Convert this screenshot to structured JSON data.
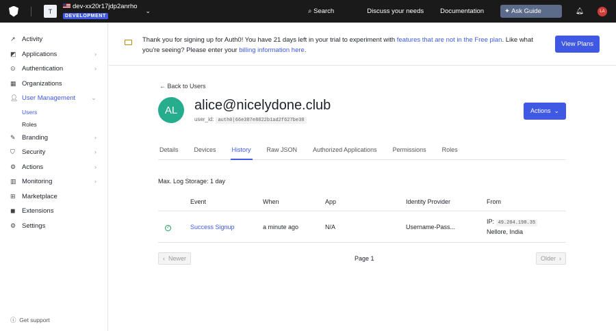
{
  "topbar": {
    "tenant_initial": "T",
    "tenant_name": "dev-xx20r17jdp2anrho",
    "env_badge": "DEVELOPMENT",
    "search": "Search",
    "discuss": "Discuss your needs",
    "docs": "Documentation",
    "ask": "Ask Guide",
    "user_initials": "LA"
  },
  "sidebar": {
    "items": [
      {
        "label": "Activity"
      },
      {
        "label": "Applications"
      },
      {
        "label": "Authentication"
      },
      {
        "label": "Organizations"
      },
      {
        "label": "User Management"
      },
      {
        "label": "Branding"
      },
      {
        "label": "Security"
      },
      {
        "label": "Actions"
      },
      {
        "label": "Monitoring"
      },
      {
        "label": "Marketplace"
      },
      {
        "label": "Extensions"
      },
      {
        "label": "Settings"
      }
    ],
    "sub": [
      "Users",
      "Roles"
    ],
    "support": "Get support"
  },
  "banner": {
    "t1": "Thank you for signing up for Auth0! You have 21 days left in your trial to experiment with ",
    "l1": "features that are not in the Free plan",
    "t2": ". Like what you're seeing? Please enter your ",
    "l2": "billing information here",
    "t3": ".",
    "button": "View Plans"
  },
  "user": {
    "back": "Back to Users",
    "initials": "AL",
    "email": "alice@nicelydone.club",
    "uid_label": "user_id:",
    "uid": "auth0|66e387e8822b1ad2f627be38",
    "actions": "Actions"
  },
  "tabs": [
    "Details",
    "Devices",
    "History",
    "Raw JSON",
    "Authorized Applications",
    "Permissions",
    "Roles"
  ],
  "history": {
    "storage": "Max. Log Storage: 1 day",
    "headers": [
      "Event",
      "When",
      "App",
      "Identity Provider",
      "From"
    ],
    "rows": [
      {
        "event": "Success Signup",
        "when": "a minute ago",
        "app": "N/A",
        "idp": "Username-Pass...",
        "ip_label": "IP:",
        "ip": "49.204.198.35",
        "location": "Nellore, India"
      }
    ]
  },
  "pager": {
    "newer": "Newer",
    "page": "Page 1",
    "older": "Older"
  }
}
